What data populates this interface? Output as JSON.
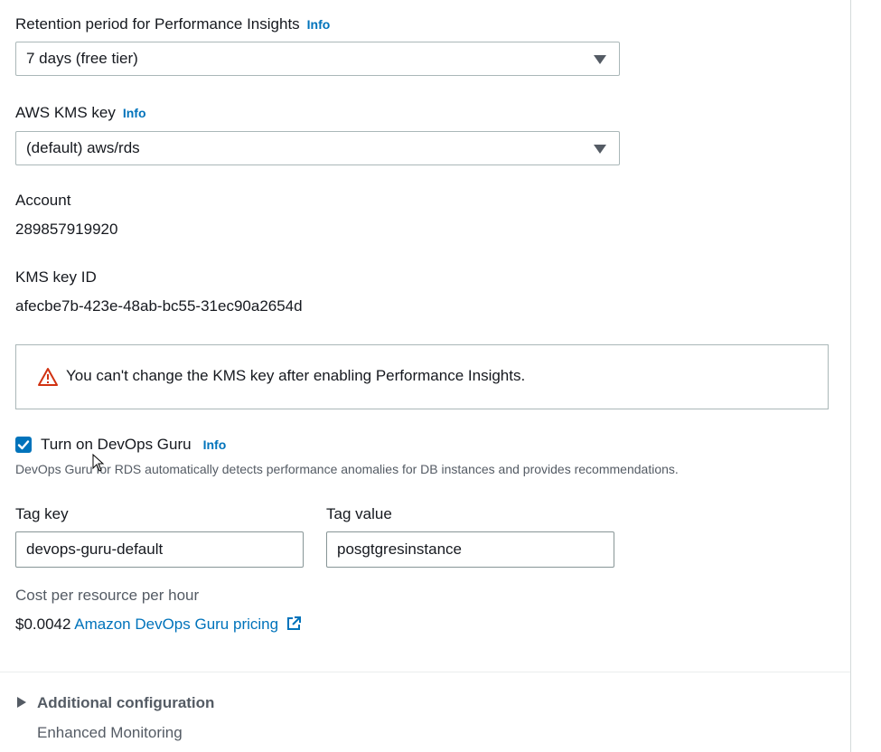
{
  "performance_insights": {
    "retention_label": "Retention period for Performance Insights",
    "retention_info": "Info",
    "retention_value": "7 days (free tier)",
    "kms_label": "AWS KMS key",
    "kms_info": "Info",
    "kms_value": "(default) aws/rds",
    "account_label": "Account",
    "account_value": "289857919920",
    "kms_key_id_label": "KMS key ID",
    "kms_key_id_value": "afecbe7b-423e-48ab-bc55-31ec90a2654d",
    "warning_text": "You can't change the KMS key after enabling Performance Insights.",
    "warning_color": "#d13212"
  },
  "devops_guru": {
    "checkbox_label": "Turn on DevOps Guru",
    "checkbox_info": "Info",
    "checked": true,
    "description": "DevOps Guru for RDS automatically detects performance anomalies for DB instances and provides recommendations.",
    "tag_key_label": "Tag key",
    "tag_key_value": "devops-guru-default",
    "tag_value_label": "Tag value",
    "tag_value_value": "posgtgresinstance",
    "cost_label": "Cost per resource per hour",
    "cost_value": "$0.0042",
    "pricing_link": "Amazon DevOps Guru pricing"
  },
  "additional_configuration": {
    "title": "Additional configuration",
    "subtitle": "Enhanced Monitoring"
  },
  "colors": {
    "link": "#0073bb",
    "checkbox": "#0073bb",
    "text": "#16191f",
    "muted": "#545b64"
  }
}
